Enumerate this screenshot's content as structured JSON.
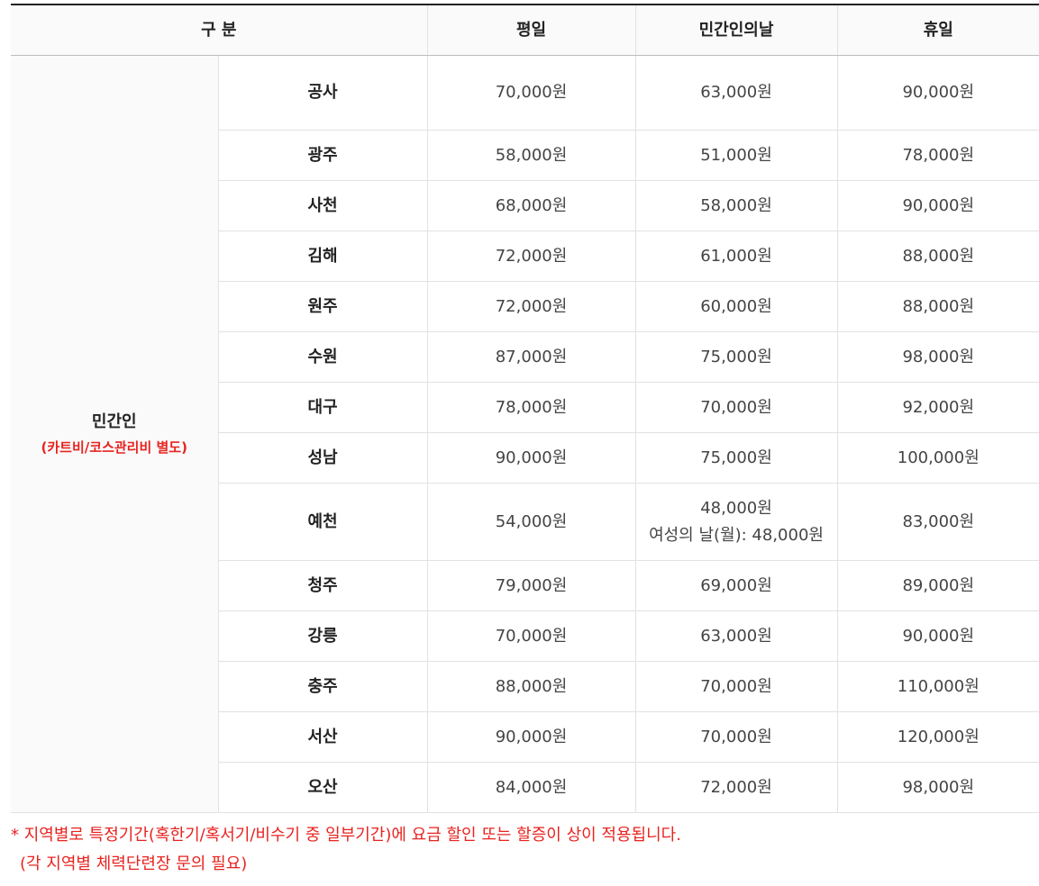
{
  "header": {
    "category": "구 분",
    "weekday": "평일",
    "civilian_day": "민간인의날",
    "holiday": "휴일"
  },
  "group": {
    "label": "민간인",
    "note": "(카트비/코스관리비 별도)"
  },
  "rows": [
    {
      "region": "공사",
      "weekday": "70,000원",
      "civilian_day": "63,000원",
      "holiday": "90,000원"
    },
    {
      "region": "광주",
      "weekday": "58,000원",
      "civilian_day": "51,000원",
      "holiday": "78,000원"
    },
    {
      "region": "사천",
      "weekday": "68,000원",
      "civilian_day": "58,000원",
      "holiday": "90,000원"
    },
    {
      "region": "김해",
      "weekday": "72,000원",
      "civilian_day": "61,000원",
      "holiday": "88,000원"
    },
    {
      "region": "원주",
      "weekday": "72,000원",
      "civilian_day": "60,000원",
      "holiday": "88,000원"
    },
    {
      "region": "수원",
      "weekday": "87,000원",
      "civilian_day": "75,000원",
      "holiday": "98,000원"
    },
    {
      "region": "대구",
      "weekday": "78,000원",
      "civilian_day": "70,000원",
      "holiday": "92,000원"
    },
    {
      "region": "성남",
      "weekday": "90,000원",
      "civilian_day": "75,000원",
      "holiday": "100,000원"
    },
    {
      "region": "예천",
      "weekday": "54,000원",
      "civilian_day": "48,000원",
      "civilian_day_extra": "여성의 날(월): 48,000원",
      "holiday": "83,000원"
    },
    {
      "region": "청주",
      "weekday": "79,000원",
      "civilian_day": "69,000원",
      "holiday": "89,000원"
    },
    {
      "region": "강릉",
      "weekday": "70,000원",
      "civilian_day": "63,000원",
      "holiday": "90,000원"
    },
    {
      "region": "충주",
      "weekday": "88,000원",
      "civilian_day": "70,000원",
      "holiday": "110,000원"
    },
    {
      "region": "서산",
      "weekday": "90,000원",
      "civilian_day": "70,000원",
      "holiday": "120,000원"
    },
    {
      "region": "오산",
      "weekday": "84,000원",
      "civilian_day": "72,000원",
      "holiday": "98,000원"
    }
  ],
  "footnote": {
    "line1": "* 지역별로 특정기간(혹한기/혹서기/비수기 중 일부기간)에 요금 할인 또는 할증이 상이 적용됩니다.",
    "line2": "(각 지역별 체력단련장 문의 필요)"
  },
  "colors": {
    "note_red": "#e8231f",
    "header_bg": "#fafafa",
    "border": "#e2e2e2"
  }
}
